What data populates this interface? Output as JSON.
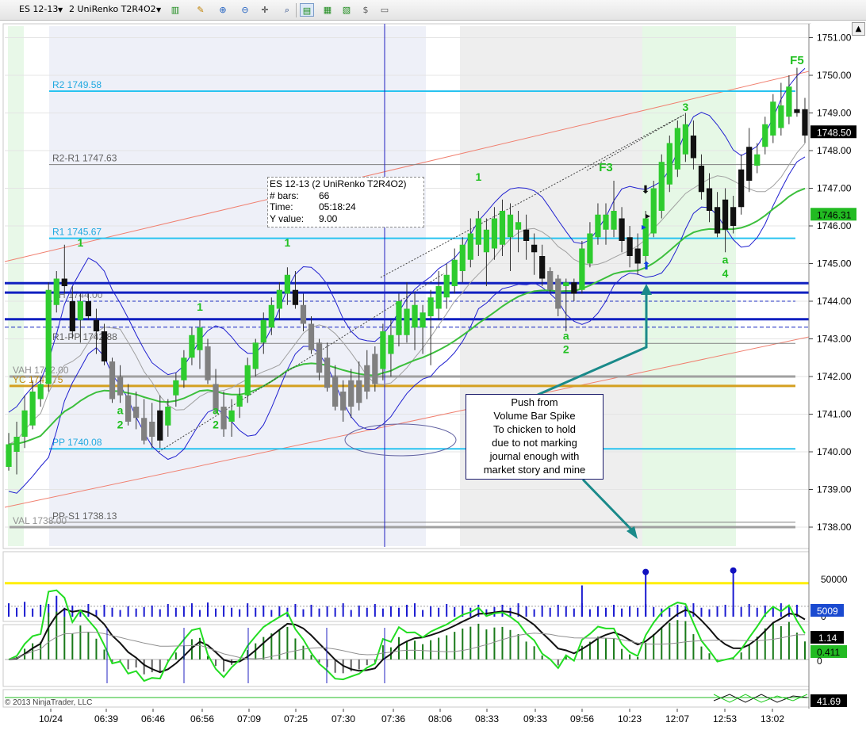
{
  "toolbar": {
    "instrument": "ES 12-13",
    "bar_type": "2 UniRenko T2R4O2"
  },
  "tooltip": {
    "title": "ES 12-13 (2 UniRenko T2R4O2)",
    "rows": [
      {
        "label": "# bars:",
        "value": "66"
      },
      {
        "label": "Time:",
        "value": "05:18:24"
      },
      {
        "label": "Y value:",
        "value": "9.00"
      }
    ]
  },
  "callout": {
    "lines": [
      "Push from",
      "Volume Bar Spike",
      "To chicken to hold",
      "due to not marking",
      "journal enough with",
      "market story and mine"
    ]
  },
  "copyright": "© 2013 NinjaTrader, LLC",
  "colors": {
    "up_bar": "#2ecc2e",
    "down_bar": "#111111",
    "gray_bar": "#808080",
    "pivot_line": "#28c3f0",
    "value_line": "#a0a0a0",
    "prior_close": "#d4a020",
    "channel": "#f08070",
    "band": "#2020d0",
    "ema": "#3cbf3c",
    "volume": "#1a1ad0",
    "threshold": "#ffee00"
  },
  "chart_data": [
    {
      "type": "candlestick",
      "y_axis": {
        "ticks": [
          1751.0,
          1750.0,
          1749.0,
          1748.0,
          1747.0,
          1746.0,
          1745.0,
          1744.0,
          1743.0,
          1742.0,
          1741.0,
          1740.0,
          1739.0,
          1738.0
        ],
        "range": [
          1737.4,
          1751.3
        ]
      },
      "x_axis": {
        "ticks": [
          "10/24",
          "06:39",
          "06:46",
          "06:56",
          "07:09",
          "07:25",
          "07:30",
          "07:36",
          "08:06",
          "08:33",
          "09:33",
          "09:56",
          "10:23",
          "12:07",
          "12:53",
          "13:02"
        ]
      },
      "last_price": "1748.50",
      "ema_value": "1746.31",
      "levels": [
        {
          "label": "R2 1749.58",
          "value": 1749.58,
          "kind": "pivot"
        },
        {
          "label": "R2-R1 1747.63",
          "value": 1747.63,
          "kind": "mid"
        },
        {
          "label": "R1 1745.67",
          "value": 1745.67,
          "kind": "pivot"
        },
        {
          "label": "YH 1744.00",
          "value": 1744.0,
          "kind": "yh"
        },
        {
          "label": "R1-PP 1742.88",
          "value": 1742.88,
          "kind": "mid"
        },
        {
          "label": "VAH 1742.00",
          "value": 1742.0,
          "kind": "value"
        },
        {
          "label": "YC 1741.75",
          "value": 1741.75,
          "kind": "close"
        },
        {
          "label": "PP 1740.08",
          "value": 1740.08,
          "kind": "pivot"
        },
        {
          "label": "PP-S1 1738.13",
          "value": 1738.13,
          "kind": "mid"
        },
        {
          "label": "VAL 1738.00",
          "value": 1738.0,
          "kind": "value"
        }
      ],
      "annotations": [
        {
          "text": "1",
          "index": 9,
          "price": 1745.45
        },
        {
          "text": "1",
          "index": 35,
          "price": 1745.45
        },
        {
          "text": "1",
          "index": 24,
          "price": 1743.75
        },
        {
          "text": "1",
          "index": 59,
          "price": 1747.2
        },
        {
          "text": "a",
          "index": 14,
          "price": 1741.0
        },
        {
          "text": "2",
          "index": 14,
          "price": 1740.62
        },
        {
          "text": "a",
          "index": 26,
          "price": 1741.0
        },
        {
          "text": "2",
          "index": 26,
          "price": 1740.62
        },
        {
          "text": "a",
          "index": 70,
          "price": 1742.98
        },
        {
          "text": "2",
          "index": 70,
          "price": 1742.62
        },
        {
          "text": "F3",
          "index": 75,
          "price": 1747.45
        },
        {
          "text": "3",
          "index": 85,
          "price": 1749.05
        },
        {
          "text": "a",
          "index": 90,
          "price": 1745.0
        },
        {
          "text": "4",
          "index": 90,
          "price": 1744.63
        },
        {
          "text": "F5",
          "index": 99,
          "price": 1750.3
        }
      ],
      "ohlc": [
        [
          1739.6,
          1740.5,
          1739.5,
          1740.2
        ],
        [
          1740.0,
          1740.8,
          1739.4,
          1740.4
        ],
        [
          1740.4,
          1741.5,
          1740.1,
          1741.1
        ],
        [
          1740.7,
          1741.9,
          1740.6,
          1741.6
        ],
        [
          1741.4,
          1742.0,
          1741.2,
          1741.8
        ],
        [
          1741.8,
          1744.5,
          1741.6,
          1744.3
        ],
        [
          1743.9,
          1744.8,
          1743.7,
          1744.6
        ],
        [
          1744.6,
          1745.5,
          1744.2,
          1744.4
        ],
        [
          1744.0,
          1744.4,
          1743.0,
          1743.2
        ],
        [
          1743.5,
          1744.2,
          1742.9,
          1744.0
        ],
        [
          1744.0,
          1744.2,
          1743.5,
          1743.6
        ],
        [
          1743.5,
          1743.8,
          1742.6,
          1743.2
        ],
        [
          1743.2,
          1743.4,
          1742.3,
          1742.4
        ],
        [
          1742.4,
          1742.5,
          1741.3,
          1741.4
        ],
        [
          1742.0,
          1742.3,
          1741.3,
          1741.5
        ],
        [
          1741.5,
          1741.8,
          1740.7,
          1740.8
        ],
        [
          1741.2,
          1741.6,
          1740.6,
          1740.9
        ],
        [
          1740.9,
          1741.4,
          1740.2,
          1740.3
        ],
        [
          1740.8,
          1741.3,
          1740.1,
          1740.4
        ],
        [
          1741.1,
          1741.5,
          1740.1,
          1740.3
        ],
        [
          1740.7,
          1741.4,
          1740.4,
          1741.2
        ],
        [
          1741.5,
          1742.1,
          1741.2,
          1741.9
        ],
        [
          1741.9,
          1742.7,
          1741.7,
          1742.5
        ],
        [
          1742.5,
          1743.3,
          1742.3,
          1743.1
        ],
        [
          1742.7,
          1743.5,
          1742.2,
          1743.3
        ],
        [
          1742.8,
          1743.0,
          1741.8,
          1741.9
        ],
        [
          1741.8,
          1742.2,
          1741.0,
          1741.1
        ],
        [
          1741.2,
          1741.6,
          1740.4,
          1740.6
        ],
        [
          1740.8,
          1741.4,
          1740.4,
          1741.1
        ],
        [
          1741.2,
          1741.7,
          1740.9,
          1741.5
        ],
        [
          1741.5,
          1742.5,
          1741.3,
          1742.3
        ],
        [
          1742.2,
          1743.0,
          1742.0,
          1742.9
        ],
        [
          1742.9,
          1743.7,
          1742.6,
          1743.5
        ],
        [
          1743.3,
          1744.1,
          1743.1,
          1743.9
        ],
        [
          1743.8,
          1744.5,
          1743.5,
          1744.3
        ],
        [
          1744.2,
          1744.9,
          1743.9,
          1744.7
        ],
        [
          1744.3,
          1744.8,
          1743.8,
          1743.9
        ],
        [
          1743.9,
          1744.2,
          1743.2,
          1743.4
        ],
        [
          1743.4,
          1743.6,
          1742.6,
          1742.7
        ],
        [
          1742.9,
          1743.0,
          1741.9,
          1742.1
        ],
        [
          1742.5,
          1742.9,
          1741.6,
          1741.7
        ],
        [
          1742.0,
          1742.3,
          1741.1,
          1741.2
        ],
        [
          1741.6,
          1741.9,
          1740.8,
          1741.1
        ],
        [
          1741.9,
          1742.2,
          1740.9,
          1741.2
        ],
        [
          1741.9,
          1742.4,
          1741.1,
          1741.3
        ],
        [
          1742.3,
          1742.7,
          1741.4,
          1741.6
        ],
        [
          1742.6,
          1742.8,
          1741.6,
          1741.8
        ],
        [
          1742.2,
          1743.4,
          1741.9,
          1743.2
        ],
        [
          1742.6,
          1743.5,
          1742.0,
          1743.1
        ],
        [
          1743.1,
          1744.2,
          1742.8,
          1744.0
        ],
        [
          1743.1,
          1744.5,
          1742.9,
          1743.8
        ],
        [
          1743.3,
          1744.2,
          1742.7,
          1743.9
        ],
        [
          1743.3,
          1743.9,
          1742.6,
          1743.7
        ],
        [
          1743.6,
          1744.3,
          1742.3,
          1744.1
        ],
        [
          1743.8,
          1744.8,
          1743.5,
          1744.4
        ],
        [
          1744.1,
          1745.0,
          1743.8,
          1744.7
        ],
        [
          1744.4,
          1745.4,
          1744.2,
          1745.1
        ],
        [
          1744.8,
          1745.7,
          1744.5,
          1745.5
        ],
        [
          1745.1,
          1746.2,
          1744.9,
          1745.8
        ],
        [
          1745.5,
          1746.4,
          1745.2,
          1746.2
        ],
        [
          1745.3,
          1746.2,
          1744.4,
          1745.9
        ],
        [
          1745.4,
          1746.5,
          1745.1,
          1746.2
        ],
        [
          1745.5,
          1746.7,
          1745.2,
          1746.4
        ],
        [
          1745.7,
          1746.6,
          1744.8,
          1746.3
        ],
        [
          1745.9,
          1746.4,
          1745.3,
          1746.1
        ],
        [
          1745.9,
          1746.3,
          1745.1,
          1745.6
        ],
        [
          1745.5,
          1745.8,
          1744.7,
          1745.3
        ],
        [
          1745.2,
          1745.5,
          1744.4,
          1744.6
        ],
        [
          1744.8,
          1744.9,
          1744.2,
          1744.3
        ],
        [
          1744.6,
          1744.7,
          1743.6,
          1743.8
        ],
        [
          1744.4,
          1744.6,
          1743.2,
          1744.5
        ],
        [
          1744.5,
          1744.6,
          1744.0,
          1744.2
        ],
        [
          1744.3,
          1745.6,
          1744.2,
          1745.4
        ],
        [
          1745.0,
          1746.1,
          1744.9,
          1745.8
        ],
        [
          1745.7,
          1746.6,
          1745.5,
          1746.3
        ],
        [
          1745.9,
          1746.6,
          1745.5,
          1746.3
        ],
        [
          1745.9,
          1747.2,
          1745.7,
          1746.4
        ],
        [
          1746.2,
          1746.5,
          1745.3,
          1745.6
        ],
        [
          1745.7,
          1746.0,
          1744.9,
          1745.2
        ],
        [
          1745.4,
          1745.8,
          1744.7,
          1745.0
        ],
        [
          1745.2,
          1746.4,
          1745.0,
          1746.2
        ],
        [
          1745.8,
          1747.2,
          1745.7,
          1747.0
        ],
        [
          1746.4,
          1747.9,
          1746.2,
          1747.7
        ],
        [
          1747.1,
          1748.4,
          1746.9,
          1748.2
        ],
        [
          1747.5,
          1748.8,
          1747.3,
          1748.6
        ],
        [
          1747.9,
          1749.0,
          1747.7,
          1748.7
        ],
        [
          1748.4,
          1748.8,
          1747.5,
          1747.8
        ],
        [
          1747.6,
          1747.9,
          1746.7,
          1746.9
        ],
        [
          1747.0,
          1747.4,
          1746.1,
          1746.4
        ],
        [
          1746.5,
          1746.9,
          1745.7,
          1745.8
        ],
        [
          1746.7,
          1747.0,
          1745.3,
          1745.9
        ],
        [
          1746.5,
          1746.8,
          1745.8,
          1746.0
        ],
        [
          1747.5,
          1747.9,
          1746.3,
          1746.5
        ],
        [
          1748.1,
          1748.6,
          1746.9,
          1747.2
        ],
        [
          1747.6,
          1748.2,
          1747.4,
          1747.9
        ],
        [
          1748.1,
          1748.9,
          1747.9,
          1748.7
        ],
        [
          1748.4,
          1749.5,
          1748.2,
          1749.3
        ],
        [
          1748.6,
          1749.8,
          1748.4,
          1749.2
        ],
        [
          1748.9,
          1750.0,
          1748.7,
          1749.7
        ],
        [
          1749.1,
          1750.2,
          1748.9,
          1749.0
        ],
        [
          1749.1,
          1749.4,
          1748.2,
          1748.4
        ]
      ]
    },
    {
      "type": "bar",
      "title": "Volume",
      "y_axis": {
        "ticks": [
          50000,
          0
        ]
      },
      "last_value": "5009",
      "threshold": 45000,
      "values": [
        18000,
        12000,
        20000,
        11000,
        16000,
        17000,
        28000,
        12000,
        15000,
        9000,
        17000,
        9000,
        16000,
        12000,
        9000,
        14000,
        11000,
        13000,
        15000,
        10000,
        17000,
        12000,
        14000,
        18000,
        9000,
        19000,
        11000,
        15000,
        12000,
        10000,
        18000,
        12000,
        15000,
        9000,
        14000,
        12000,
        17000,
        10000,
        16000,
        11000,
        14000,
        12000,
        18000,
        9000,
        15000,
        12000,
        17000,
        11000,
        14000,
        12000,
        16000,
        18000,
        9000,
        14000,
        12000,
        17000,
        13000,
        15000,
        12000,
        16000,
        10000,
        13000,
        16000,
        12000,
        18000,
        14000,
        10000,
        15000,
        12000,
        16000,
        14000,
        11000,
        18000,
        10000,
        14000,
        12000,
        16000,
        11000,
        14000,
        12000,
        17000,
        13000,
        11000,
        12000,
        16000,
        14000,
        18000,
        12000,
        10000,
        14000,
        16000,
        12000,
        13000,
        17000,
        12000,
        15000,
        12000,
        18000,
        14000,
        16000
      ]
    },
    {
      "type": "line",
      "title": "Oscillator",
      "last_values": [
        "1.14",
        "0.411"
      ],
      "y_axis": {
        "ticks": [
          0
        ]
      }
    },
    {
      "type": "line",
      "title": "Oscillator 2",
      "last_value": "41.69"
    }
  ]
}
